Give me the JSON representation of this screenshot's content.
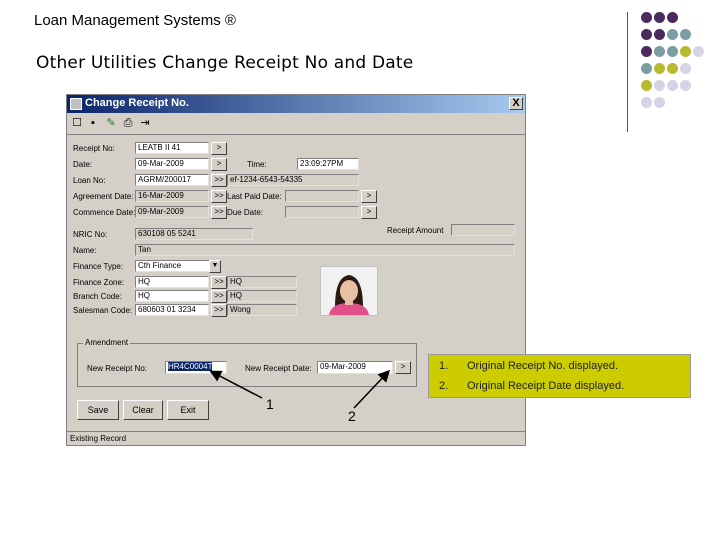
{
  "slide": {
    "brand": "Loan Management Systems ®",
    "title": "Other Utilities Change Receipt No and Date"
  },
  "decor": {
    "dot_colors": {
      "purple": "#4b2a5e",
      "teal": "#7a9ea2",
      "olive": "#b8b92e",
      "lavender": "#d6d3e6"
    }
  },
  "window": {
    "title": "Change Receipt No.",
    "close_label": "X",
    "toolbar_icons": [
      "new-icon",
      "save-icon",
      "edit-icon",
      "print-icon",
      "exit-icon"
    ],
    "fields": {
      "receipt_no": {
        "label": "Receipt No:",
        "value": "LEATB II 41"
      },
      "date": {
        "label": "Date:",
        "value": "09-Mar-2009"
      },
      "time": {
        "label": "Time:",
        "value": "23:09:27PM"
      },
      "loan_no": {
        "label": "Loan No:",
        "value": "AGRM/200017"
      },
      "loan_no_2": {
        "value": "ef-1234-6543-54335"
      },
      "agreement_date": {
        "label": "Agreement Date:",
        "value": "16-Mar-2009"
      },
      "last_paid_date": {
        "label": "Last Paid Date:",
        "value": ""
      },
      "commence_date": {
        "label": "Commence Date:",
        "value": "09-Mar-2009"
      },
      "due_date": {
        "label": "Due Date:",
        "value": ""
      },
      "receipt_amount": {
        "label": "Receipt Amount",
        "value": ""
      },
      "nric": {
        "label": "NRIC No:",
        "value": "630108 05 5241"
      },
      "name": {
        "label": "Name:",
        "value": "Tan"
      },
      "finance_type": {
        "label": "Finance Type:",
        "value": "Cth Finance"
      },
      "finance_zone": {
        "label": "Finance Zone:",
        "value": "HQ",
        "desc": "HQ"
      },
      "branch_code": {
        "label": "Branch Code:",
        "value": "HQ",
        "desc": "HQ"
      },
      "salesman_code": {
        "label": "Salesman Code:",
        "value": "680603 01 3234",
        "desc": "Wong"
      }
    },
    "amendment": {
      "group_label": "Amendment",
      "new_receipt_label": "New Receipt No:",
      "new_receipt_value": "HR4C0004T",
      "new_receipt_date_label": "New Receipt Date:",
      "new_receipt_date_value": "09-Mar-2009"
    },
    "buttons": {
      "save": "Save",
      "clear": "Clear",
      "exit": "Exit"
    },
    "small_btn": ">",
    "small_btn_double": ">>",
    "status": "Existing Record"
  },
  "callouts": {
    "marker_1": "1",
    "marker_2": "2",
    "items": [
      {
        "num": "1.",
        "text": "Original Receipt No. displayed."
      },
      {
        "num": "2.",
        "text": "Original Receipt Date displayed."
      }
    ]
  }
}
